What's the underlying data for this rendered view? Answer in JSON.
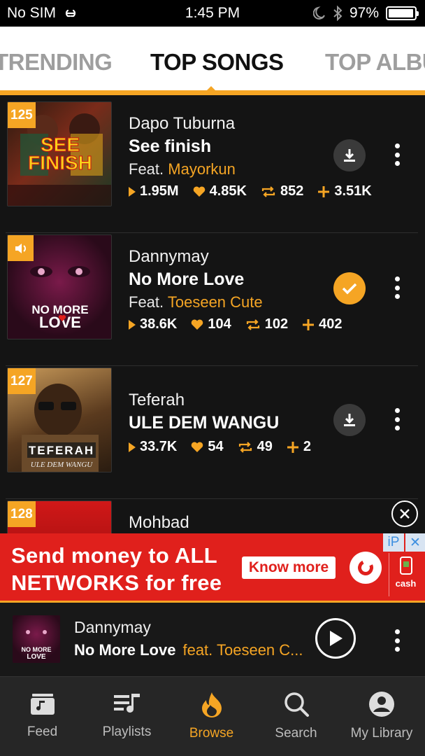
{
  "status_bar": {
    "carrier": "No SIM",
    "time": "1:45 PM",
    "battery": "97%",
    "battery_level": 0.97
  },
  "tabs": [
    {
      "label": "TRENDING",
      "active": false
    },
    {
      "label": "TOP SONGS",
      "active": true
    },
    {
      "label": "TOP ALBUMS",
      "active": false
    }
  ],
  "songs": [
    {
      "rank": "125",
      "artist": "Dapo Tuburna",
      "title": "See finish",
      "feat_label": "Feat.",
      "feat_artist": "Mayorkun",
      "plays": "1.95M",
      "likes": "4.85K",
      "reposts": "852",
      "adds": "3.51K",
      "downloaded": false
    },
    {
      "rank": "",
      "playing": true,
      "artist": "Dannymay",
      "title": "No More Love",
      "feat_label": "Feat.",
      "feat_artist": "Toeseen Cute",
      "plays": "38.6K",
      "likes": "104",
      "reposts": "102",
      "adds": "402",
      "downloaded": true
    },
    {
      "rank": "127",
      "artist": "Teferah",
      "title": "ULE DEM WANGU",
      "plays": "33.7K",
      "likes": "54",
      "reposts": "49",
      "adds": "2",
      "downloaded": false
    },
    {
      "rank": "128",
      "artist": "Mohbad"
    }
  ],
  "ad": {
    "line1": "Send money to ALL",
    "line2": "NETWORKS for free",
    "button": "Know more",
    "cash_label": "cash",
    "badge_ip": "iP",
    "badge_x": "✕"
  },
  "now_playing": {
    "artist": "Dannymay",
    "title": "No More Love",
    "feat": "feat. Toeseen C..."
  },
  "nav": [
    {
      "label": "Feed",
      "icon": "music-note-icon",
      "active": false
    },
    {
      "label": "Playlists",
      "icon": "playlist-icon",
      "active": false
    },
    {
      "label": "Browse",
      "icon": "flame-icon",
      "active": true
    },
    {
      "label": "Search",
      "icon": "search-icon",
      "active": false
    },
    {
      "label": "My Library",
      "icon": "user-icon",
      "active": false
    }
  ],
  "colors": {
    "accent": "#f5a524",
    "background": "#141414",
    "ad_red": "#e0201c"
  }
}
